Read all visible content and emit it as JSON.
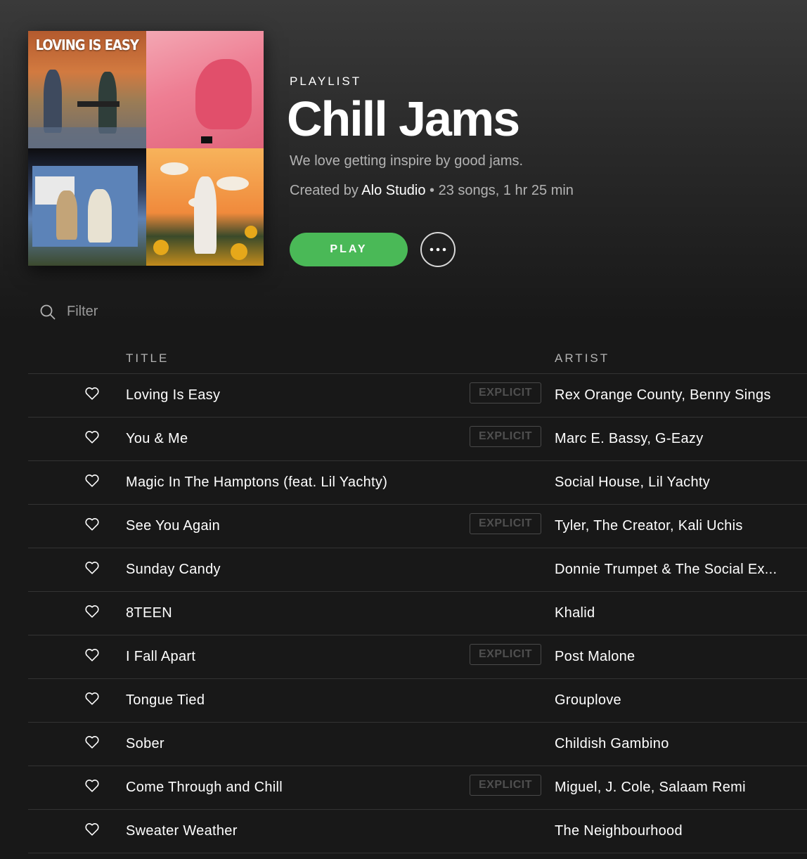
{
  "playlist": {
    "type_label": "PLAYLIST",
    "title": "Chill Jams",
    "description": "We love getting inspire by good jams.",
    "created_prefix": "Created by ",
    "owner": "Alo Studio",
    "stats": " • 23 songs, 1 hr 25 min",
    "cover_text": "LOVING IS EASY"
  },
  "actions": {
    "play_label": "PLAY",
    "more_icon": "ellipsis-icon"
  },
  "filter": {
    "placeholder": "Filter",
    "icon": "search-icon"
  },
  "table": {
    "headers": {
      "title": "TITLE",
      "artist": "ARTIST"
    },
    "explicit_label": "EXPLICIT",
    "rows": [
      {
        "title": "Loving Is Easy",
        "artist": "Rex Orange County, Benny Sings",
        "explicit": true
      },
      {
        "title": "You & Me",
        "artist": "Marc E. Bassy, G-Eazy",
        "explicit": true
      },
      {
        "title": "Magic In The Hamptons (feat. Lil Yachty)",
        "artist": "Social House, Lil Yachty",
        "explicit": false
      },
      {
        "title": "See You Again",
        "artist": "Tyler, The Creator, Kali Uchis",
        "explicit": true
      },
      {
        "title": "Sunday Candy",
        "artist": "Donnie Trumpet & The Social Ex...",
        "explicit": false
      },
      {
        "title": "8TEEN",
        "artist": "Khalid",
        "explicit": false
      },
      {
        "title": "I Fall Apart",
        "artist": "Post Malone",
        "explicit": true
      },
      {
        "title": "Tongue Tied",
        "artist": "Grouplove",
        "explicit": false
      },
      {
        "title": "Sober",
        "artist": "Childish Gambino",
        "explicit": false
      },
      {
        "title": "Come Through and Chill",
        "artist": "Miguel, J. Cole, Salaam Remi",
        "explicit": true
      },
      {
        "title": "Sweater Weather",
        "artist": "The Neighbourhood",
        "explicit": false
      }
    ]
  },
  "colors": {
    "accent": "#4ab957",
    "background": "#181818",
    "muted_text": "#b3b3b3"
  }
}
